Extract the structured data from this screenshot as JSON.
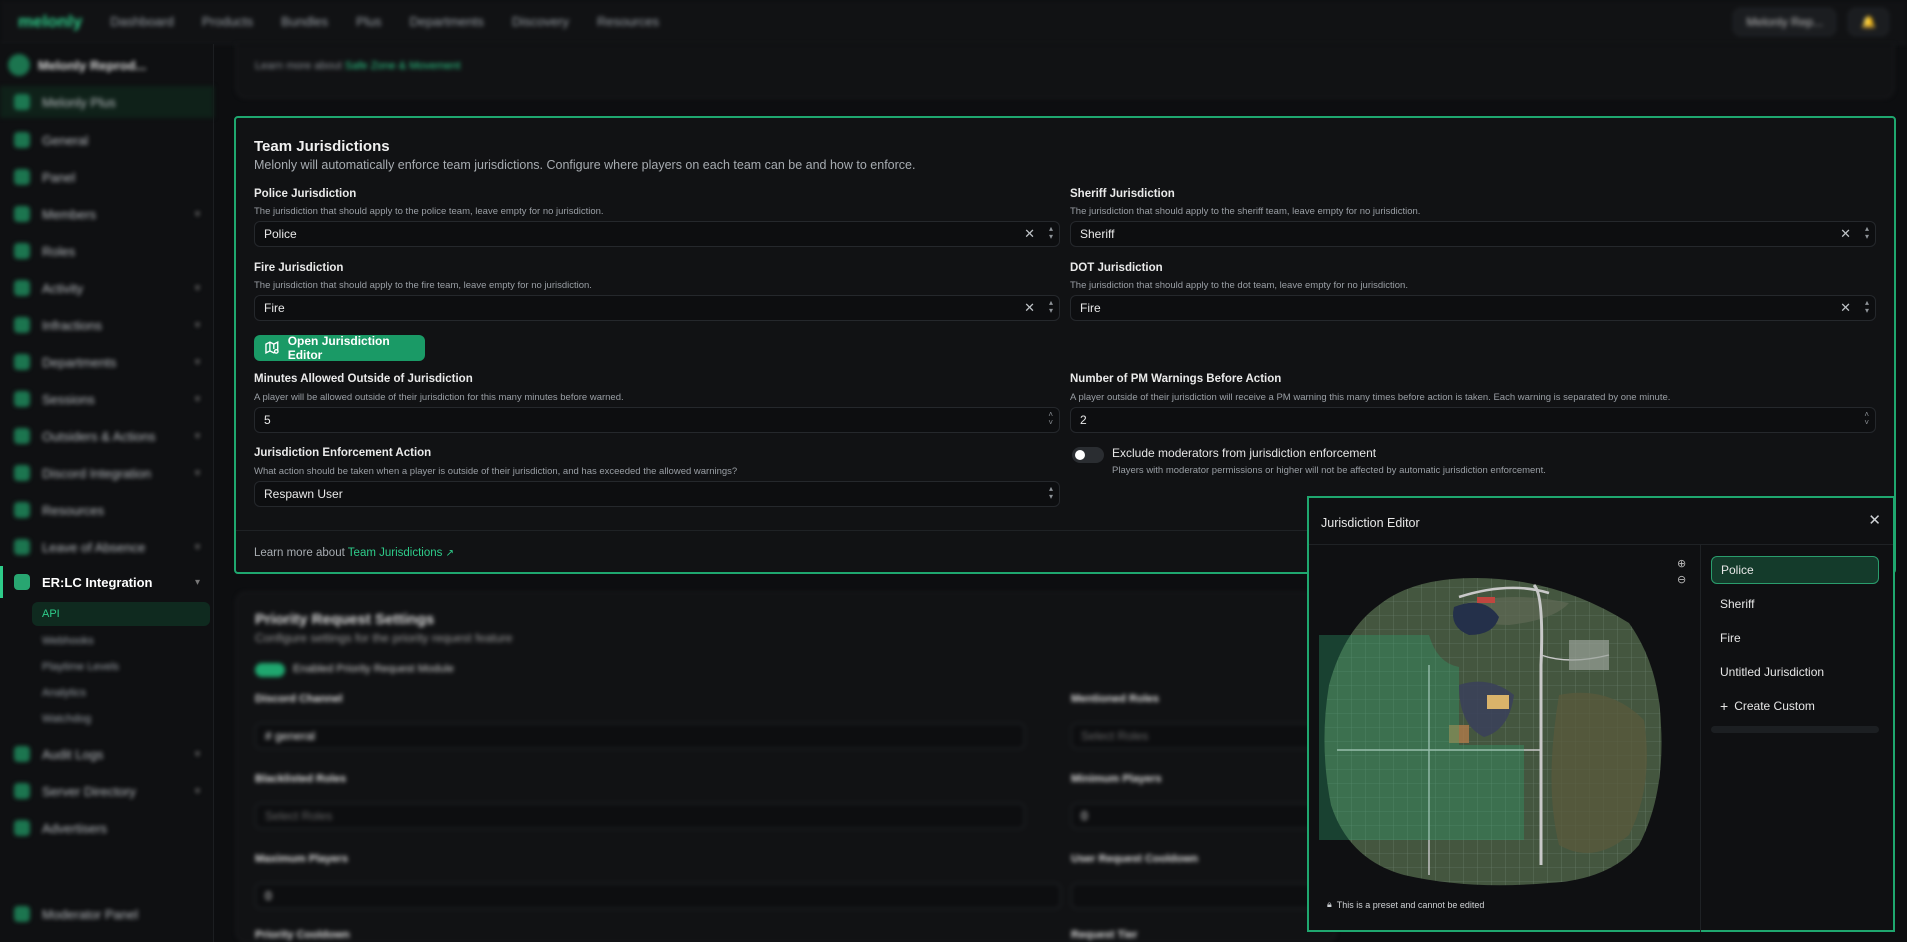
{
  "nav": {
    "logo": "melonly",
    "links": [
      "Dashboard",
      "Products",
      "Bundles",
      "Plus",
      "Departments",
      "Discovery",
      "Resources"
    ],
    "user": "Melonly Rep..."
  },
  "sidebar": {
    "server": "Melonly Reprod...",
    "items": [
      {
        "label": "Melonly Plus"
      },
      {
        "label": "General"
      },
      {
        "label": "Panel"
      },
      {
        "label": "Members"
      },
      {
        "label": "Roles"
      },
      {
        "label": "Activity"
      },
      {
        "label": "Infractions"
      },
      {
        "label": "Departments"
      },
      {
        "label": "Sessions"
      },
      {
        "label": "Outsiders & Actions"
      },
      {
        "label": "Discord Integration"
      },
      {
        "label": "Resources"
      },
      {
        "label": "Leave of Absence"
      },
      {
        "label": "ER:LC Integration"
      },
      {
        "label": "Audit Logs"
      },
      {
        "label": "Server Directory"
      },
      {
        "label": "Advertisers"
      },
      {
        "label": "Moderator Panel"
      }
    ],
    "subitems": [
      {
        "label": "API"
      },
      {
        "label": "Webhooks"
      },
      {
        "label": "Playtime Levels"
      },
      {
        "label": "Analytics"
      },
      {
        "label": "Watchdog"
      }
    ]
  },
  "top_card": {
    "learn_prefix": "Learn more about",
    "learn_link": "Safe Zone & Movement"
  },
  "team_jurisdictions": {
    "title": "Team Jurisdictions",
    "description": "Melonly will automatically enforce team jurisdictions. Configure where players on each team can be and how to enforce.",
    "police": {
      "label": "Police Jurisdiction",
      "help": "The jurisdiction that should apply to the police team, leave empty for no jurisdiction.",
      "value": "Police"
    },
    "sheriff": {
      "label": "Sheriff Jurisdiction",
      "help": "The jurisdiction that should apply to the sheriff team, leave empty for no jurisdiction.",
      "value": "Sheriff"
    },
    "fire": {
      "label": "Fire Jurisdiction",
      "help": "The jurisdiction that should apply to the fire team, leave empty for no jurisdiction.",
      "value": "Fire"
    },
    "dot": {
      "label": "DOT Jurisdiction",
      "help": "The jurisdiction that should apply to the dot team, leave empty for no jurisdiction.",
      "value": "Fire"
    },
    "open_editor_button": "Open Jurisdiction Editor",
    "minutes": {
      "label": "Minutes Allowed Outside of Jurisdiction",
      "help": "A player will be allowed outside of their jurisdiction for this many minutes before warned.",
      "value": "5"
    },
    "warnings": {
      "label": "Number of PM Warnings Before Action",
      "help": "A player outside of their jurisdiction will receive a PM warning this many times before action is taken. Each warning is separated by one minute.",
      "value": "2"
    },
    "action": {
      "label": "Jurisdiction Enforcement Action",
      "help": "What action should be taken when a player is outside of their jurisdiction, and has exceeded the allowed warnings?",
      "value": "Respawn User"
    },
    "exclude": {
      "label": "Exclude moderators from jurisdiction enforcement",
      "help": "Players with moderator permissions or higher will not be affected by automatic jurisdiction enforcement.",
      "enabled": false
    },
    "learn_prefix": "Learn more about",
    "learn_link": "Team Jurisdictions"
  },
  "priority": {
    "title": "Priority Request Settings",
    "description": "Configure settings for the priority request feature",
    "toggle_label": "Enabled Priority Request Module",
    "discord_channel": "Discord Channel",
    "channel_value": "# general",
    "blacklisted_roles": "Blacklisted Roles",
    "roles_placeholder": "Select Roles",
    "maximum_players": "Maximum Players",
    "max_value": "0",
    "priority_cooldown": "Priority Cooldown",
    "mentioned_roles": "Mentioned Roles",
    "minimum_players": "Minimum Players",
    "min_value": "0",
    "user_cooldown": "User Request Cooldown",
    "request_tier": "Request Tier"
  },
  "modal": {
    "title": "Jurisdiction Editor",
    "preset_note": "This is a preset and cannot be edited",
    "jurisdictions": [
      "Police",
      "Sheriff",
      "Fire",
      "Untitled Jurisdiction"
    ],
    "create_custom": "Create Custom",
    "accent": "#1fa76f"
  }
}
